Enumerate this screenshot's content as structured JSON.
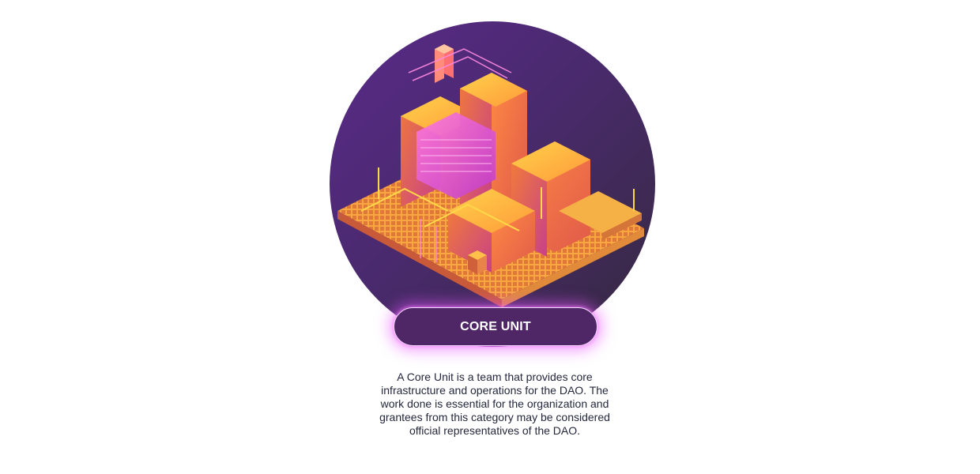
{
  "category": {
    "badge_label": "CORE UNIT",
    "description": "A Core Unit is a team that provides core infrastructure and operations for the DAO. The work done is essential for the organization and grantees from this category may be considered official representatives of the DAO."
  },
  "colors": {
    "badge_background": "#4f2766",
    "badge_glow": "#e854ff",
    "circle_gradient_start": "#5a2a8a",
    "circle_gradient_end": "#35293f",
    "text": "#25273d"
  }
}
